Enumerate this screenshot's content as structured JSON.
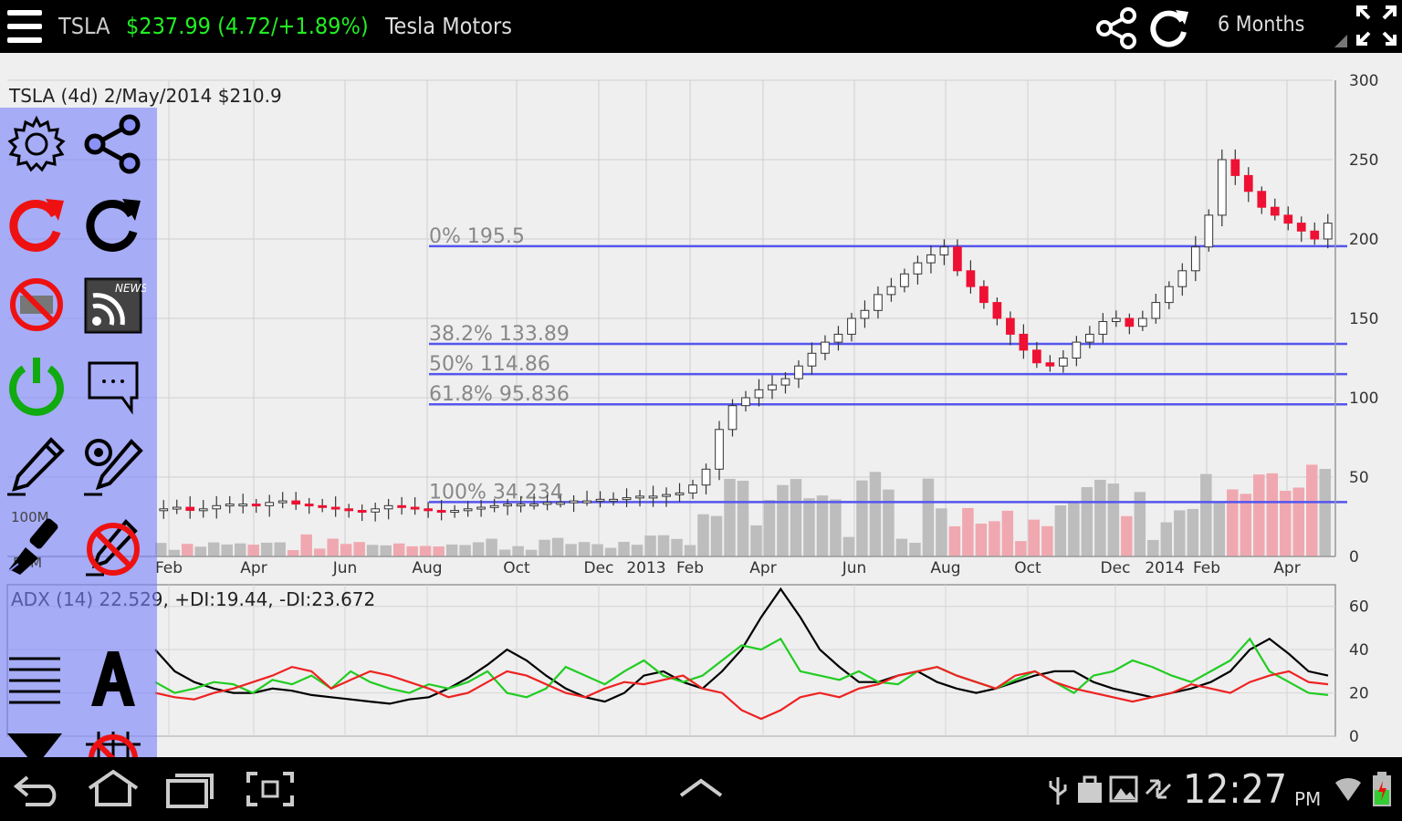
{
  "topbar": {
    "ticker": "TSLA",
    "price_change": "$237.99 (4.72/+1.89%)",
    "company": "Tesla Motors",
    "period": "6 Months"
  },
  "price_chart": {
    "header": "TSLA (4d) 2/May/2014 $210.9",
    "y_ticks": [
      "300",
      "250",
      "200",
      "150",
      "100",
      "50",
      "0"
    ],
    "x_ticks": [
      "Feb",
      "Apr",
      "Jun",
      "Aug",
      "Oct",
      "Dec",
      "2013",
      "Feb",
      "Apr",
      "Jun",
      "Aug",
      "Oct",
      "Dec",
      "2014",
      "Feb",
      "Apr"
    ],
    "left_axis_labels": [
      "100M",
      "50M"
    ],
    "fib_levels": [
      {
        "label": "0% 195.5",
        "value": 195.5
      },
      {
        "label": "38.2% 133.89",
        "value": 133.89
      },
      {
        "label": "50% 114.86",
        "value": 114.86
      },
      {
        "label": "61.8% 95.836",
        "value": 95.836
      },
      {
        "label": "100% 34.234",
        "value": 34.234
      }
    ]
  },
  "adx_chart": {
    "header": "ADX (14) 22.529, +DI:19.44, -DI:23.672",
    "y_ticks": [
      "60",
      "40",
      "20",
      "0"
    ]
  },
  "tools": [
    {
      "name": "settings-icon"
    },
    {
      "name": "share-icon"
    },
    {
      "name": "refresh-red-icon"
    },
    {
      "name": "refresh-icon"
    },
    {
      "name": "no-ads-icon"
    },
    {
      "name": "news-feed-icon"
    },
    {
      "name": "power-icon"
    },
    {
      "name": "comment-icon"
    },
    {
      "name": "draw-pencil-icon"
    },
    {
      "name": "draw-target-icon"
    },
    {
      "name": "brush-icon"
    },
    {
      "name": "no-draw-icon"
    },
    {
      "name": "lines-icon"
    },
    {
      "name": "text-icon"
    },
    {
      "name": "filter-icon"
    },
    {
      "name": "no-grid-icon"
    }
  ],
  "statusbar": {
    "time": "12:27",
    "ampm": "PM"
  },
  "colors": {
    "accent_green": "#22ee22",
    "fib_line": "#5555ee",
    "up_candle": "#ffffff",
    "down_candle": "#ee1133",
    "adx_line": "#000000",
    "plus_di": "#22cc22",
    "minus_di": "#ee2222",
    "tool_panel": "#8a92f5"
  },
  "chart_data": [
    {
      "type": "candlestick",
      "title": "TSLA (4d) 2/May/2014 $210.9",
      "x_ticks": [
        "Feb",
        "Apr",
        "Jun",
        "Aug",
        "Oct",
        "Dec",
        "2013",
        "Feb",
        "Apr",
        "Jun",
        "Aug",
        "Oct",
        "Dec",
        "2014",
        "Feb",
        "Apr"
      ],
      "ylim": [
        0,
        300
      ],
      "close": [
        30,
        31,
        29,
        30,
        32,
        33,
        33,
        32,
        34,
        35,
        33,
        32,
        31,
        30,
        29,
        28,
        30,
        32,
        31,
        30,
        29,
        28,
        29,
        30,
        31,
        32,
        33,
        33,
        33,
        34,
        34,
        35,
        35,
        36,
        36,
        37,
        38,
        38,
        39,
        40,
        45,
        55,
        80,
        95,
        100,
        105,
        108,
        112,
        120,
        128,
        135,
        140,
        150,
        155,
        165,
        170,
        178,
        185,
        190,
        195,
        180,
        170,
        160,
        150,
        140,
        130,
        122,
        120,
        125,
        135,
        140,
        148,
        150,
        145,
        150,
        160,
        170,
        180,
        195,
        215,
        250,
        240,
        230,
        220,
        215,
        210,
        205,
        200,
        210
      ],
      "fib_levels": [
        {
          "label": "0% 195.5",
          "value": 195.5
        },
        {
          "label": "38.2% 133.89",
          "value": 133.89
        },
        {
          "label": "50% 114.86",
          "value": 114.86
        },
        {
          "label": "61.8% 95.836",
          "value": 95.836
        },
        {
          "label": "100% 34.234",
          "value": 34.234
        }
      ]
    },
    {
      "type": "line",
      "title": "ADX (14) 22.529, +DI:19.44, -DI:23.672",
      "ylim": [
        0,
        70
      ],
      "series": [
        {
          "name": "ADX",
          "values": [
            40,
            30,
            25,
            22,
            20,
            20,
            22,
            21,
            19,
            18,
            17,
            16,
            15,
            17,
            18,
            22,
            27,
            33,
            40,
            35,
            28,
            22,
            18,
            16,
            20,
            28,
            30,
            25,
            22,
            30,
            40,
            55,
            68,
            55,
            40,
            32,
            25,
            25,
            28,
            30,
            25,
            22,
            20,
            22,
            25,
            28,
            30,
            30,
            25,
            22,
            20,
            18,
            20,
            22,
            25,
            30,
            40,
            45,
            38,
            30,
            28
          ]
        },
        {
          "name": "+DI",
          "values": [
            25,
            20,
            22,
            25,
            24,
            20,
            26,
            24,
            28,
            22,
            30,
            25,
            22,
            20,
            24,
            22,
            25,
            30,
            20,
            18,
            22,
            32,
            28,
            24,
            30,
            35,
            28,
            25,
            28,
            35,
            42,
            40,
            45,
            30,
            28,
            26,
            30,
            25,
            24,
            30,
            32,
            28,
            25,
            22,
            26,
            30,
            25,
            20,
            28,
            30,
            35,
            32,
            28,
            25,
            30,
            35,
            45,
            30,
            25,
            20,
            19
          ]
        },
        {
          "name": "-DI",
          "values": [
            20,
            18,
            17,
            20,
            22,
            25,
            28,
            32,
            30,
            22,
            26,
            30,
            28,
            25,
            22,
            18,
            20,
            25,
            30,
            28,
            24,
            20,
            18,
            22,
            25,
            24,
            26,
            28,
            22,
            20,
            12,
            8,
            12,
            18,
            20,
            18,
            22,
            24,
            28,
            30,
            32,
            28,
            25,
            22,
            28,
            30,
            25,
            22,
            20,
            18,
            16,
            18,
            20,
            24,
            22,
            20,
            25,
            28,
            30,
            25,
            24
          ]
        }
      ]
    }
  ]
}
